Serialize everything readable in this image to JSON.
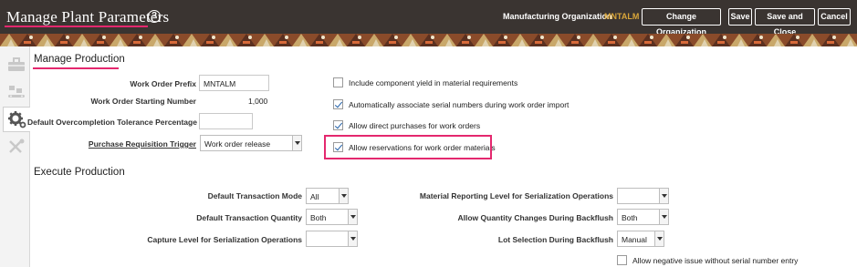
{
  "header": {
    "title": "Manage Plant Parameters",
    "help_icon": "?",
    "org_label": "Manufacturing Organization",
    "org_value": "MNTALM",
    "buttons": {
      "change_org": "Change Organization",
      "save": "Save",
      "save_close": "Save and Close",
      "cancel": "Cancel"
    }
  },
  "colors": {
    "topbar": "#3a3431",
    "accent": "#e4286e",
    "org_value": "#d9a63a",
    "check": "#1f5fa8"
  },
  "sidebar": {
    "icons": [
      "toolbox-icon",
      "conveyor-icon",
      "gear-icon",
      "tools-icon"
    ],
    "active_index": 2
  },
  "manage_production": {
    "title": "Manage Production",
    "work_order_prefix": {
      "label": "Work Order Prefix",
      "value": "MNTALM"
    },
    "work_order_starting_number": {
      "label": "Work Order Starting Number",
      "value": "1,000"
    },
    "overcompletion_tolerance": {
      "label": "Default Overcompletion Tolerance Percentage",
      "value": ""
    },
    "purchase_requisition_trigger": {
      "label": "Purchase Requisition Trigger",
      "value": "Work order release"
    },
    "checkboxes": [
      {
        "label": "Include component yield in material requirements",
        "checked": false
      },
      {
        "label": "Automatically associate serial numbers during work order import",
        "checked": true
      },
      {
        "label": "Allow direct purchases for work orders",
        "checked": true
      },
      {
        "label": "Allow reservations for work order materials",
        "checked": true
      }
    ]
  },
  "execute_production": {
    "title": "Execute Production",
    "default_transaction_mode": {
      "label": "Default Transaction Mode",
      "value": "All"
    },
    "default_transaction_quantity": {
      "label": "Default Transaction Quantity",
      "value": "Both"
    },
    "capture_level_serialization": {
      "label": "Capture Level for Serialization Operations",
      "value": ""
    },
    "material_reporting_level": {
      "label": "Material Reporting Level for Serialization Operations",
      "value": ""
    },
    "allow_quantity_changes": {
      "label": "Allow Quantity Changes During Backflush",
      "value": "Both"
    },
    "lot_selection": {
      "label": "Lot Selection During Backflush",
      "value": "Manual"
    },
    "negative_issue": {
      "label": "Allow negative issue without serial number entry",
      "checked": false
    }
  }
}
